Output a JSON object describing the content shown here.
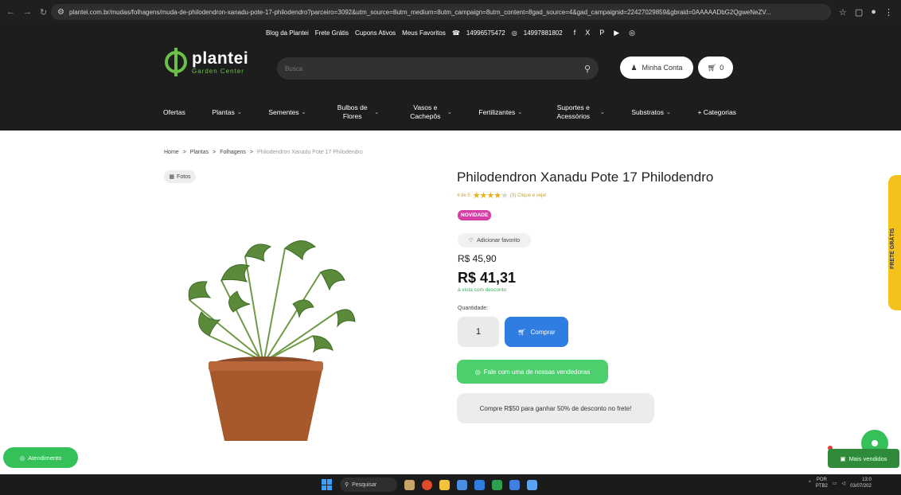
{
  "browser": {
    "url": "plantei.com.br/mudas/folhagens/muda-de-philodendron-xanadu-pote-17-philodendro?parceiro=3092&utm_source=8utm_medium=8utm_campaign=8utm_content=8gad_source=4&gad_campaignid=22427029859&gbraid=0AAAAADbG2QgweNeZV..."
  },
  "topbar": {
    "links": [
      "Blog da Plantei",
      "Frete Grátis",
      "Cupons Ativos",
      "Meus Favoritos"
    ],
    "phone": "14996575472",
    "whatsapp": "14997881802"
  },
  "header": {
    "logo_name": "plantei",
    "logo_sub": "Garden Center",
    "search_placeholder": "Busca",
    "account_label": "Minha Conta",
    "cart_count": "0"
  },
  "menu": [
    {
      "label": "Ofertas",
      "caret": ""
    },
    {
      "label": "Plantas",
      "caret": "⌄"
    },
    {
      "label": "Sementes",
      "caret": "⌄"
    },
    {
      "label": "Bulbos de Flores",
      "caret": "⌄"
    },
    {
      "label": "Vasos e Cachepôs",
      "caret": "⌄"
    },
    {
      "label": "Fertilizantes",
      "caret": "⌄"
    },
    {
      "label": "Suportes e Acessórios",
      "caret": "⌄"
    },
    {
      "label": "Substratos",
      "caret": "⌄"
    },
    {
      "label": "+ Categorias",
      "caret": ""
    }
  ],
  "breadcrumb": {
    "items": [
      "Home",
      "Plantas",
      "Folhagens"
    ],
    "current": "Philodendron Xanadu Pote 17 Philodendro",
    "separator": ">"
  },
  "gallery": {
    "photos_label": "Fotos"
  },
  "product": {
    "title": "Philodendron Xanadu Pote 17 Philodendro",
    "rating_text": "4 de 5",
    "rating_value": 4,
    "rating_max": 5,
    "reviews_text": "(3) Clique e veja!",
    "badge": "NOVIDADE",
    "favorite_label": "Adicionar favorito",
    "old_price": "R$ 45,90",
    "price": "R$ 41,31",
    "price_note": "à vista com desconto",
    "qty_label": "Quantidade:",
    "qty_value": "1",
    "buy_label": "Comprar",
    "chat_label": "Fale com uma de nossas vendedoras",
    "promo_text": "Compre R$50 para ganhar 50% de desconto no frete!"
  },
  "side_tab": {
    "label": "FRETE GRÁTIS"
  },
  "floating": {
    "atendimento": "Atendimento",
    "mais_vendidos": "Mais vendidos"
  },
  "taskbar": {
    "search_label": "Pesquisar",
    "lang_top": "POR",
    "lang_bottom": "PTB2",
    "time": "13:0",
    "date": "03/07/202"
  },
  "colors": {
    "header_bg": "#1d1d1d",
    "brand_green": "#6cc04a",
    "buy_blue": "#2f7de1",
    "whatsapp_green": "#4bd06d",
    "badge_pink": "#d63fa6",
    "star_gold": "#e7b21d"
  }
}
